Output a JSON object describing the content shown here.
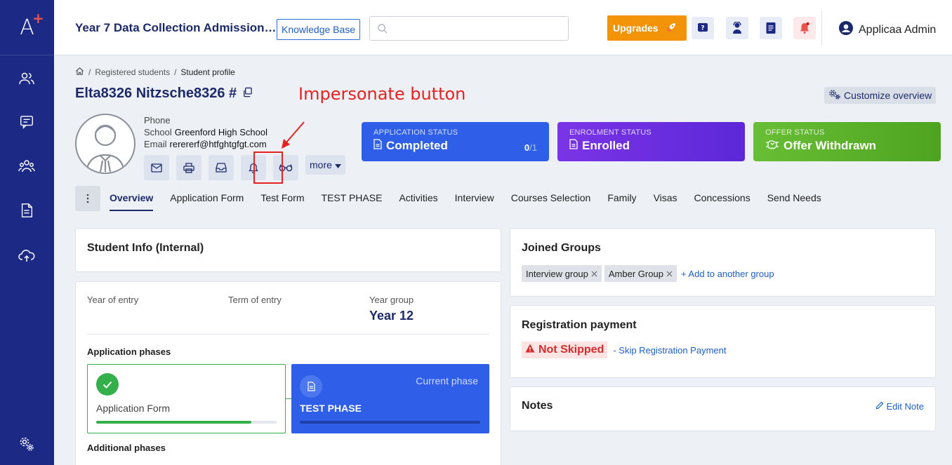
{
  "topbar": {
    "app_title": "Year 7 Data Collection Admission…",
    "knowledge_base": "Knowledge Base",
    "search_placeholder": "",
    "upgrades": "Upgrades",
    "user_name": "Applicaa Admin"
  },
  "breadcrumb": {
    "level1": "Registered students",
    "sep": "/",
    "current": "Student profile"
  },
  "student": {
    "name": "Elta8326 Nitzsche8326 #",
    "phone_label": "Phone",
    "school_label": "School",
    "school_value": "Greenford High School",
    "email_label": "Email",
    "email_value": "rerererf@htfghtgfgt.com"
  },
  "annotation": {
    "text": "Impersonate button"
  },
  "customize": "Customize overview",
  "actions": {
    "more_label": "more"
  },
  "statuses": {
    "application": {
      "label": "APPLICATION STATUS",
      "value": "Completed",
      "count": "0",
      "total": "/1",
      "color": "#2f5ee8"
    },
    "enrolment": {
      "label": "ENROLMENT STATUS",
      "value": "Enrolled",
      "color": "#6c2ee0"
    },
    "offer": {
      "label": "OFFER STATUS",
      "value": "Offer Withdrawn",
      "color": "#55b02b"
    }
  },
  "tabs": {
    "overview": "Overview",
    "application_form": "Application Form",
    "test_form": "Test Form",
    "test_phase": "TEST PHASE",
    "activities": "Activities",
    "interview": "Interview",
    "courses": "Courses Selection",
    "family": "Family",
    "visas": "Visas",
    "concessions": "Concessions",
    "send_needs": "Send Needs"
  },
  "student_info": {
    "title": "Student Info (Internal)",
    "year_of_entry_label": "Year of entry",
    "term_of_entry_label": "Term of entry",
    "year_group_label": "Year group",
    "year_group_value": "Year 12",
    "phases_title": "Application phases",
    "phase1_name": "Application Form",
    "phase1_progress": 0.86,
    "phase2_current": "Current phase",
    "phase2_name": "TEST PHASE",
    "additional_title": "Additional phases"
  },
  "groups": {
    "title": "Joined Groups",
    "tag1": "Interview group",
    "tag2": "Amber Group",
    "add_link": "+ Add to another group"
  },
  "payment": {
    "title": "Registration payment",
    "status": "Not Skipped",
    "link": "- Skip Registration Payment"
  },
  "notes": {
    "title": "Notes",
    "edit": "Edit Note"
  }
}
